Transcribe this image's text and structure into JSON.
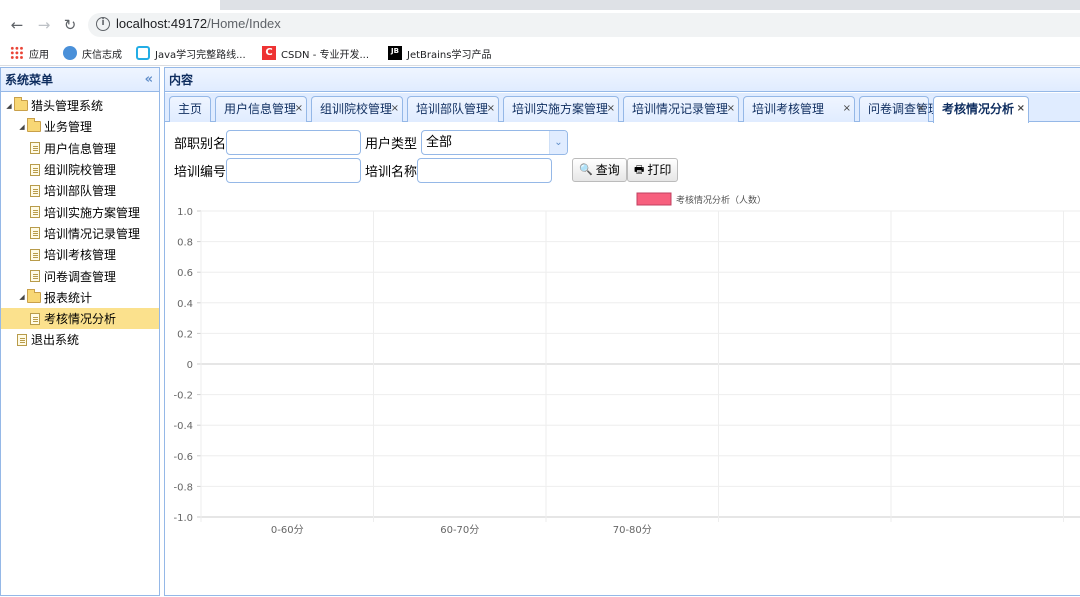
{
  "browser": {
    "url_host": "localhost:49172",
    "url_path": "/Home/Index"
  },
  "bookmarks": [
    {
      "label": "应用",
      "icon": "apps-icon"
    },
    {
      "label": "庆信志成",
      "icon": "bookmark-icon"
    },
    {
      "label": "Java学习完整路线...",
      "icon": "bilibili-icon"
    },
    {
      "label": "CSDN - 专业开发...",
      "icon": "csdn-icon"
    },
    {
      "label": "JetBrains学习产品",
      "icon": "jetbrains-icon"
    }
  ],
  "sidebar": {
    "title": "系统菜单",
    "collapse_icon": "«",
    "tree": [
      {
        "label": "猎头管理系统",
        "level": 0,
        "type": "folder",
        "expanded": true
      },
      {
        "label": "业务管理",
        "level": 1,
        "type": "folder",
        "expanded": true
      },
      {
        "label": "用户信息管理",
        "level": 2,
        "type": "file"
      },
      {
        "label": "组训院校管理",
        "level": 2,
        "type": "file"
      },
      {
        "label": "培训部队管理",
        "level": 2,
        "type": "file"
      },
      {
        "label": "培训实施方案管理",
        "level": 2,
        "type": "file"
      },
      {
        "label": "培训情况记录管理",
        "level": 2,
        "type": "file"
      },
      {
        "label": "培训考核管理",
        "level": 2,
        "type": "file"
      },
      {
        "label": "问卷调查管理",
        "level": 2,
        "type": "file"
      },
      {
        "label": "报表统计",
        "level": 1,
        "type": "folder",
        "expanded": true
      },
      {
        "label": "考核情况分析",
        "level": 2,
        "type": "file",
        "selected": true
      },
      {
        "label": "退出系统",
        "level": 1,
        "type": "file"
      }
    ]
  },
  "main": {
    "title": "内容",
    "tabs": [
      {
        "label": "主页",
        "closable": false
      },
      {
        "label": "用户信息管理",
        "closable": true
      },
      {
        "label": "组训院校管理",
        "closable": true
      },
      {
        "label": "培训部队管理",
        "closable": true
      },
      {
        "label": "培训实施方案管理",
        "closable": true
      },
      {
        "label": "培训情况记录管理",
        "closable": true
      },
      {
        "label": "培训考核管理",
        "closable": true
      },
      {
        "label": "问卷调查管理",
        "closable": true
      },
      {
        "label": "考核情况分析",
        "closable": true,
        "active": true
      }
    ],
    "close_glyph": "×"
  },
  "form": {
    "dept_label": "部职别名",
    "dept_value": "",
    "user_type_label": "用户类型",
    "user_type_value": "全部",
    "train_no_label": "培训编号",
    "train_no_value": "",
    "train_name_label": "培训名称",
    "train_name_value": "",
    "query_button": "查询",
    "print_button": "打印"
  },
  "chart_data": {
    "type": "bar",
    "legend": "考核情况分析（人数）",
    "legend_color": "#f7607e",
    "categories": [
      "0-60分",
      "60-70分",
      "70-80分"
    ],
    "series": [
      {
        "name": "考核情况分析（人数）",
        "values": [
          0,
          0,
          0
        ]
      }
    ],
    "yticks": [
      "1.0",
      "0.8",
      "0.6",
      "0.4",
      "0.2",
      "0",
      "-0.2",
      "-0.4",
      "-0.6",
      "-0.8",
      "-1.0"
    ],
    "ylim": [
      -1.0,
      1.0
    ],
    "grid": true,
    "legend_position": "top"
  }
}
